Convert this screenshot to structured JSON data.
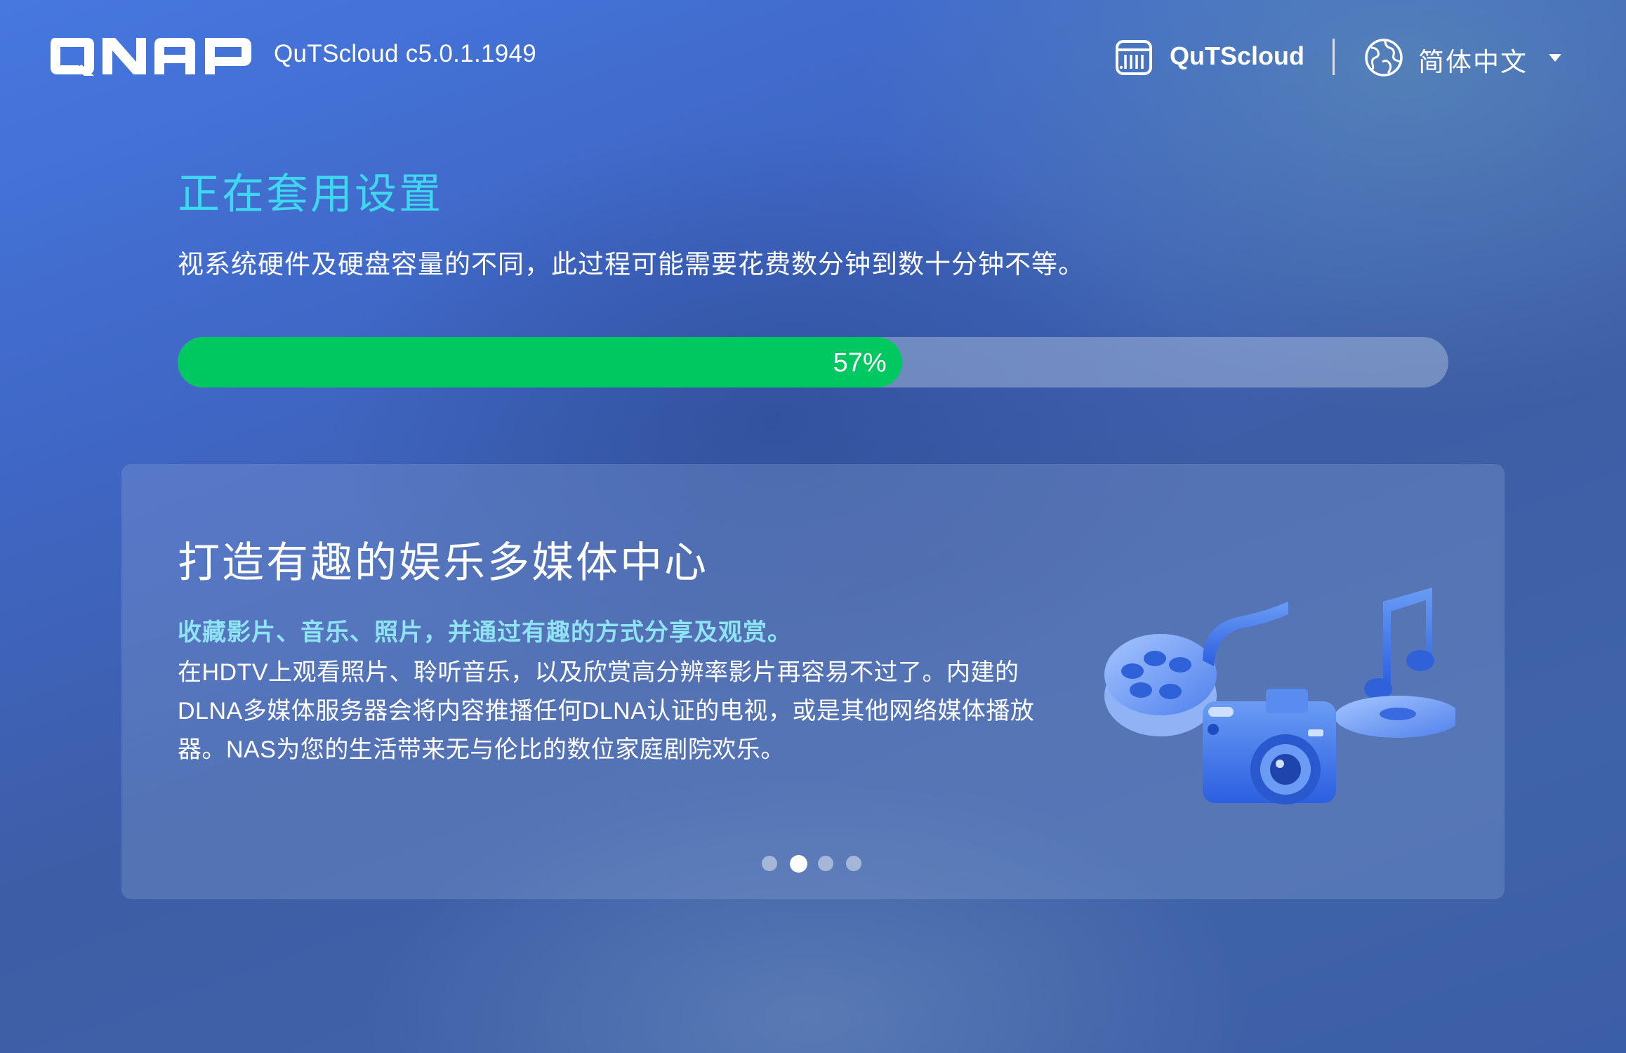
{
  "header": {
    "logo_text": "QNAP",
    "version": "QuTScloud c5.0.1.1949",
    "product_icon": "qutscloud-icon",
    "product_label": "QuTScloud",
    "language_icon": "globe-icon",
    "language_label": "简体中文"
  },
  "status": {
    "title": "正在套用设置",
    "description": "视系统硬件及硬盘容量的不同，此过程可能需要花费数分钟到数十分钟不等。",
    "progress_percent": 57,
    "progress_label": "57%"
  },
  "card": {
    "title": "打造有趣的娱乐多媒体中心",
    "subtitle": "收藏影片、音乐、照片，并通过有趣的方式分享及观赏。",
    "body": "在HDTV上观看照片、聆听音乐，以及欣赏高分辨率影片再容易不过了。内建的DLNA多媒体服务器会将内容推播任何DLNA认证的电视，或是其他网络媒体播放器。NAS为您的生活带来无与伦比的数位家庭剧院欢乐。",
    "illustration": "multimedia-illustration",
    "carousel": {
      "count": 4,
      "active_index": 1
    }
  },
  "colors": {
    "title_accent": "#3fd6f0",
    "subtitle_accent": "#8ee4f4",
    "progress_fill": "#00c860"
  }
}
